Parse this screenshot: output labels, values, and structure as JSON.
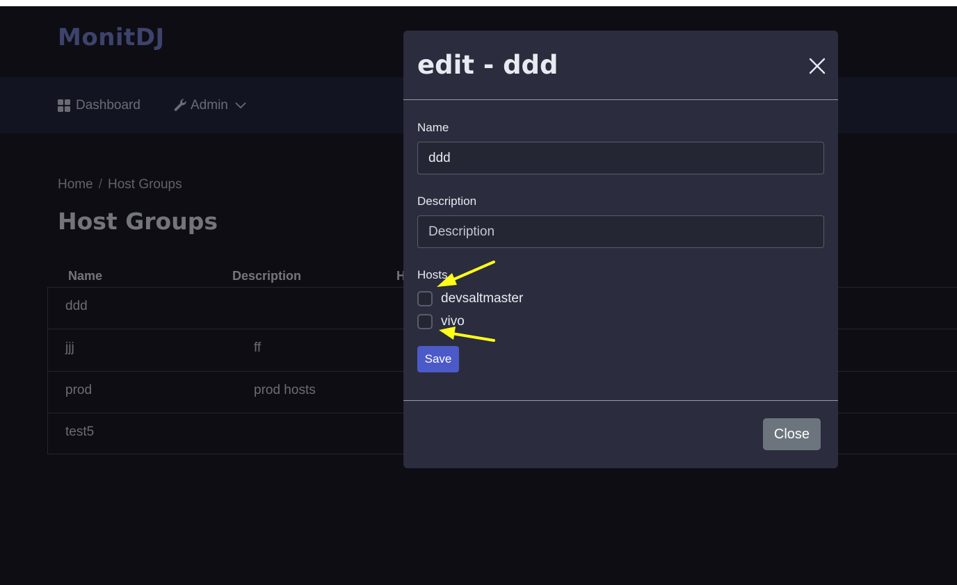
{
  "app": {
    "brand": "MonitDJ"
  },
  "nav": {
    "dashboard_label": "Dashboard",
    "admin_label": "Admin"
  },
  "breadcrumb": {
    "home": "Home",
    "separator": "/",
    "current": "Host Groups"
  },
  "page": {
    "title": "Host Groups"
  },
  "table": {
    "columns": [
      "Name",
      "Description",
      "H"
    ],
    "rows": [
      {
        "name": "ddd",
        "description": ""
      },
      {
        "name": "jjj",
        "description": "ff"
      },
      {
        "name": "prod",
        "description": "prod hosts"
      },
      {
        "name": "test5",
        "description": ""
      }
    ]
  },
  "modal": {
    "title": "edit - ddd",
    "name_label": "Name",
    "name_value": "ddd",
    "description_label": "Description",
    "description_placeholder": "Description",
    "hosts_label": "Hosts",
    "hosts": [
      {
        "label": "devsaltmaster",
        "checked": false
      },
      {
        "label": "vivo",
        "checked": false
      }
    ],
    "save_label": "Save",
    "close_label": "Close"
  },
  "colors": {
    "brand": "#7b86d8",
    "primary": "#4c5ac8",
    "secondary": "#6c757d",
    "annotation_arrow": "#ffff1a"
  }
}
